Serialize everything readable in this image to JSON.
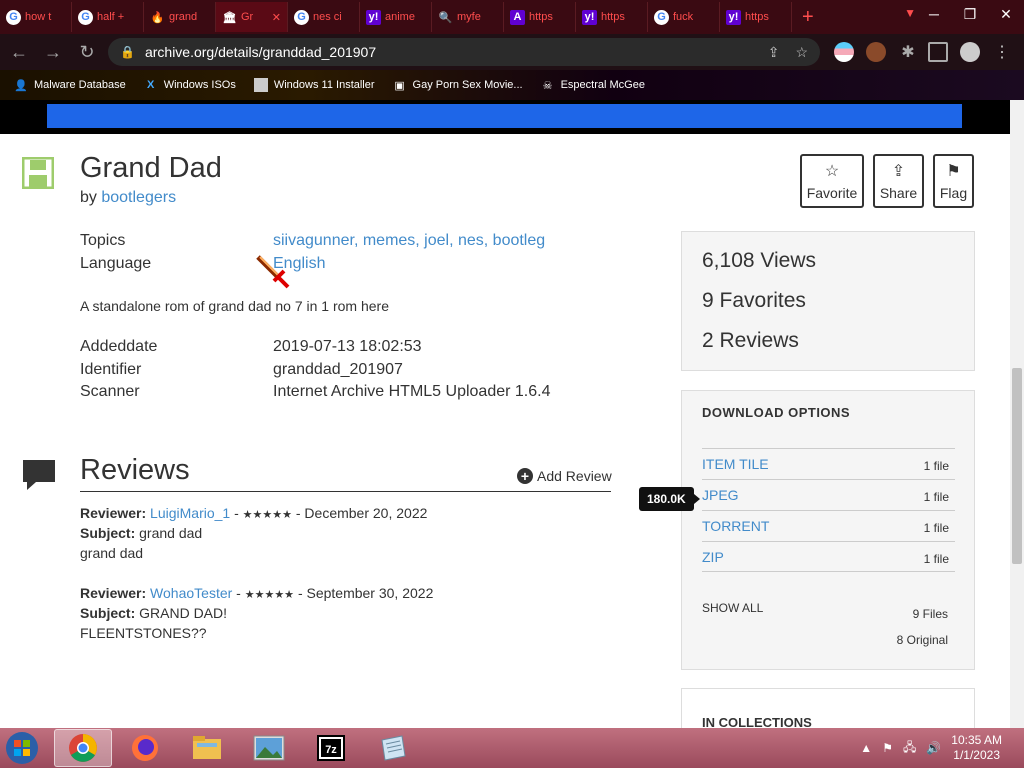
{
  "browser": {
    "tabs": [
      {
        "label": "how t",
        "fav": "G"
      },
      {
        "label": "half +",
        "fav": "G"
      },
      {
        "label": "grand",
        "fav": "🔥"
      },
      {
        "label": "Gr",
        "fav": "🏛"
      },
      {
        "label": "nes ci",
        "fav": "G"
      },
      {
        "label": "anime",
        "fav": "y!"
      },
      {
        "label": "myfe",
        "fav": "🔍"
      },
      {
        "label": "https",
        "fav": "A"
      },
      {
        "label": "https",
        "fav": "y!"
      },
      {
        "label": "fuck",
        "fav": "G"
      },
      {
        "label": "https",
        "fav": "y!"
      }
    ],
    "url": "archive.org/details/granddad_201907",
    "bookmarks": [
      {
        "label": "Malware Database"
      },
      {
        "label": "Windows ISOs"
      },
      {
        "label": "Windows 11 Installer"
      },
      {
        "label": "Gay Porn Sex Movie..."
      },
      {
        "label": "Espectral McGee"
      }
    ]
  },
  "item": {
    "title": "Grand Dad",
    "by_label": "by",
    "author": "bootlegers",
    "actions": {
      "favorite": "Favorite",
      "share": "Share",
      "flag": "Flag"
    },
    "topics_label": "Topics",
    "topics": "siivagunner, memes, joel, nes, bootleg",
    "language_label": "Language",
    "language": "English",
    "description": "A standalone rom of grand dad no 7 in 1 rom here",
    "addeddate_label": "Addeddate",
    "addeddate": "2019-07-13 18:02:53",
    "identifier_label": "Identifier",
    "identifier": "granddad_201907",
    "scanner_label": "Scanner",
    "scanner": "Internet Archive HTML5 Uploader 1.6.4"
  },
  "stats": {
    "views": "6,108 Views",
    "favorites": "9 Favorites",
    "reviews": "2 Reviews"
  },
  "downloads": {
    "heading": "DOWNLOAD OPTIONS",
    "rows": [
      {
        "name": "ITEM TILE",
        "count": "1 file"
      },
      {
        "name": "JPEG",
        "count": "1 file"
      },
      {
        "name": "TORRENT",
        "count": "1 file"
      },
      {
        "name": "ZIP",
        "count": "1 file"
      }
    ],
    "show_all": "SHOW ALL",
    "total_files": "9 Files",
    "original": "8 Original",
    "tooltip": "180.0K"
  },
  "collections": {
    "heading": "IN COLLECTIONS"
  },
  "reviews": {
    "heading": "Reviews",
    "add_label": "Add Review",
    "reviewer_label": "Reviewer:",
    "subject_label": "Subject:",
    "items": [
      {
        "reviewer": "LuigiMario_1",
        "stars": "★★★★★",
        "date": "- December 20, 2022",
        "subject": "grand dad",
        "body": "grand dad"
      },
      {
        "reviewer": "WohaoTester",
        "stars": "★★★★★",
        "date": "- September 30, 2022",
        "subject": "GRAND DAD!",
        "body": "FLEENTSTONES??"
      }
    ]
  },
  "taskbar": {
    "time": "10:35 AM",
    "date": "1/1/2023"
  }
}
